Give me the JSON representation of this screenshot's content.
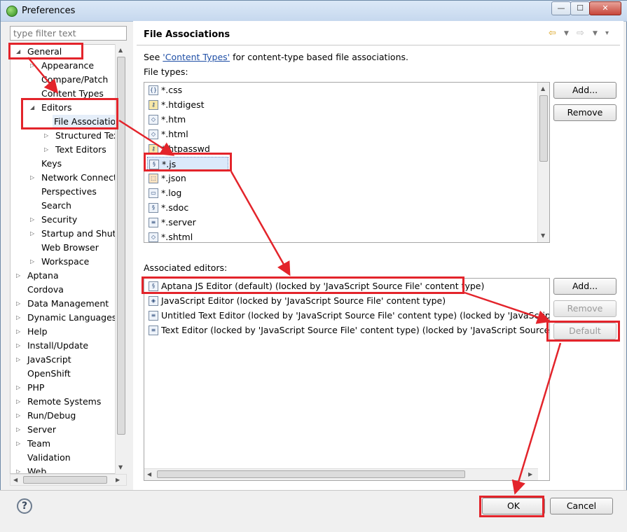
{
  "window": {
    "title": "Preferences",
    "minimize": "—",
    "maximize": "☐",
    "close": "✕"
  },
  "filter": {
    "placeholder": "type filter text"
  },
  "tree": {
    "general": "General",
    "appearance": "Appearance",
    "compare_patch": "Compare/Patch",
    "content_types": "Content Types",
    "editors": "Editors",
    "file_associations": "File Associatio",
    "structured_text": "Structured Text",
    "text_editors": "Text Editors",
    "keys": "Keys",
    "network": "Network Connectio",
    "perspectives": "Perspectives",
    "search": "Search",
    "security": "Security",
    "startup": "Startup and Shutd",
    "web_browser": "Web Browser",
    "workspace": "Workspace",
    "aptana": "Aptana",
    "cordova": "Cordova",
    "data_management": "Data Management",
    "dynamic_languages": "Dynamic Languages",
    "help": "Help",
    "install_update": "Install/Update",
    "javascript": "JavaScript",
    "openshift": "OpenShift",
    "php": "PHP",
    "remote_systems": "Remote Systems",
    "run_debug": "Run/Debug",
    "server": "Server",
    "team": "Team",
    "validation": "Validation",
    "web": "Web"
  },
  "page": {
    "title": "File Associations",
    "see_prefix": "See ",
    "see_link": "'Content Types'",
    "see_suffix": " for content-type based file associations.",
    "file_types_label": "File types:",
    "associated_label": "Associated editors:"
  },
  "file_types": [
    "*.css",
    "*.htdigest",
    "*.htm",
    "*.html",
    "*.htpasswd",
    "*.js",
    "*.json",
    "*.log",
    "*.sdoc",
    "*.server",
    "*.shtml"
  ],
  "editors": [
    "Aptana JS Editor (default) (locked by 'JavaScript Source File' content type)",
    "JavaScript Editor (locked by 'JavaScript Source File' content type)",
    "Untitled Text Editor (locked by 'JavaScript Source File' content type) (locked by 'JavaScript Sour",
    "Text Editor (locked by 'JavaScript Source File' content type) (locked by 'JavaScript Source File' c"
  ],
  "buttons": {
    "add1": "Add...",
    "remove1": "Remove",
    "add2": "Add...",
    "remove2": "Remove",
    "default": "Default",
    "ok": "OK",
    "cancel": "Cancel",
    "help": "?"
  },
  "accent": {
    "annotation_red": "#e3242b",
    "selection": "#dbe9fb"
  }
}
